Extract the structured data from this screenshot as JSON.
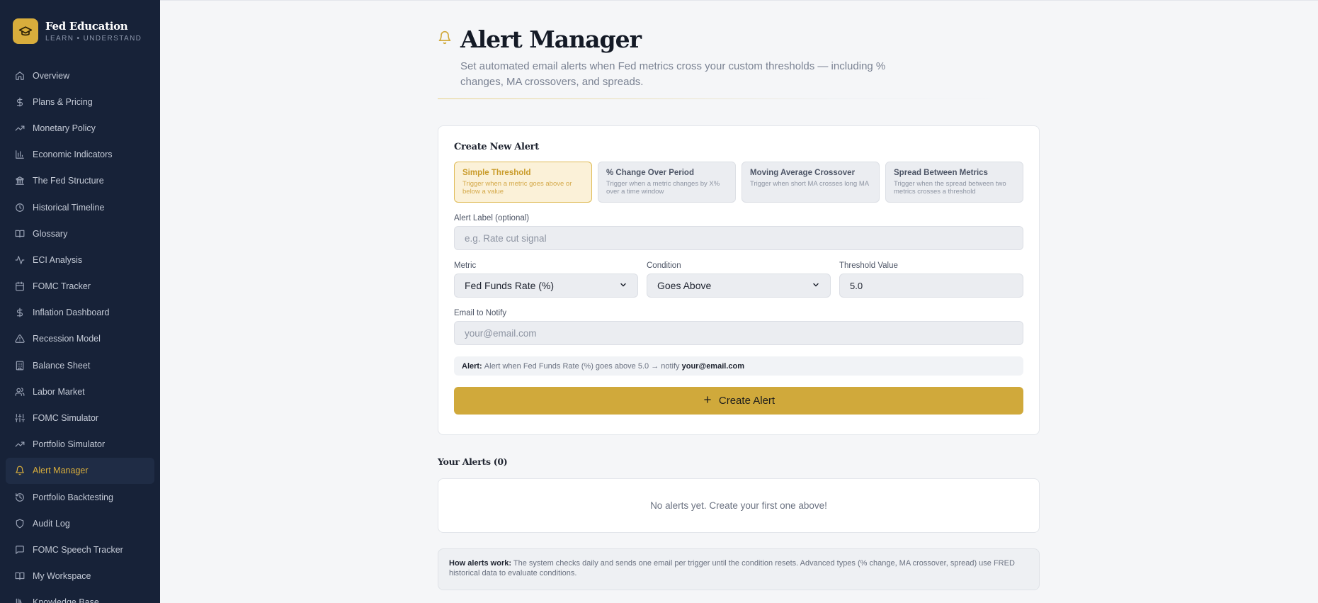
{
  "brand": {
    "name": "Fed Education",
    "tagline": "LEARN • UNDERSTAND"
  },
  "sidebar": {
    "items": [
      {
        "label": "Overview",
        "icon": "home-icon"
      },
      {
        "label": "Plans & Pricing",
        "icon": "dollar-icon"
      },
      {
        "label": "Monetary Policy",
        "icon": "trending-up-icon"
      },
      {
        "label": "Economic Indicators",
        "icon": "bar-chart-icon"
      },
      {
        "label": "The Fed Structure",
        "icon": "bank-icon"
      },
      {
        "label": "Historical Timeline",
        "icon": "clock-icon"
      },
      {
        "label": "Glossary",
        "icon": "book-icon"
      },
      {
        "label": "ECI Analysis",
        "icon": "activity-icon"
      },
      {
        "label": "FOMC Tracker",
        "icon": "calendar-icon"
      },
      {
        "label": "Inflation Dashboard",
        "icon": "dollar-icon"
      },
      {
        "label": "Recession Model",
        "icon": "warning-icon"
      },
      {
        "label": "Balance Sheet",
        "icon": "building-icon"
      },
      {
        "label": "Labor Market",
        "icon": "users-icon"
      },
      {
        "label": "FOMC Simulator",
        "icon": "sliders-icon"
      },
      {
        "label": "Portfolio Simulator",
        "icon": "trending-up-icon"
      },
      {
        "label": "Alert Manager",
        "icon": "bell-icon",
        "active": true
      },
      {
        "label": "Portfolio Backtesting",
        "icon": "history-icon"
      },
      {
        "label": "Audit Log",
        "icon": "shield-icon"
      },
      {
        "label": "FOMC Speech Tracker",
        "icon": "message-icon"
      },
      {
        "label": "My Workspace",
        "icon": "book-open-icon"
      },
      {
        "label": "Knowledge Base",
        "icon": "library-icon"
      }
    ]
  },
  "header": {
    "title": "Alert Manager",
    "subtitle": "Set automated email alerts when Fed metrics cross your custom thresholds — including % changes, MA crossovers, and spreads."
  },
  "create": {
    "title": "Create New Alert",
    "types": [
      {
        "title": "Simple Threshold",
        "desc": "Trigger when a metric goes above or below a value",
        "active": true
      },
      {
        "title": "% Change Over Period",
        "desc": "Trigger when a metric changes by X% over a time window"
      },
      {
        "title": "Moving Average Crossover",
        "desc": "Trigger when short MA crosses long MA"
      },
      {
        "title": "Spread Between Metrics",
        "desc": "Trigger when the spread between two metrics crosses a threshold"
      }
    ],
    "label_field": {
      "label": "Alert Label (optional)",
      "placeholder": "e.g. Rate cut signal"
    },
    "metric": {
      "label": "Metric",
      "value": "Fed Funds Rate (%)"
    },
    "condition": {
      "label": "Condition",
      "value": "Goes Above"
    },
    "threshold": {
      "label": "Threshold Value",
      "value": "5.0"
    },
    "email": {
      "label": "Email to Notify",
      "placeholder": "your@email.com"
    },
    "preview": {
      "prefix": "Alert:",
      "text": "Alert when Fed Funds Rate (%) goes above 5.0 → notify",
      "email": "your@email.com"
    },
    "button": "Create Alert"
  },
  "alerts": {
    "title": "Your Alerts (0)",
    "empty": "No alerts yet. Create your first one above!"
  },
  "info": {
    "prefix": "How alerts work:",
    "text": "The system checks daily and sends one email per trigger until the condition resets. Advanced types (% change, MA crossover, spread) use FRED historical data to evaluate conditions."
  },
  "colors": {
    "sidebar_bg": "#172238",
    "accent": "#d0a93b",
    "page_bg": "#f5f6f8"
  }
}
